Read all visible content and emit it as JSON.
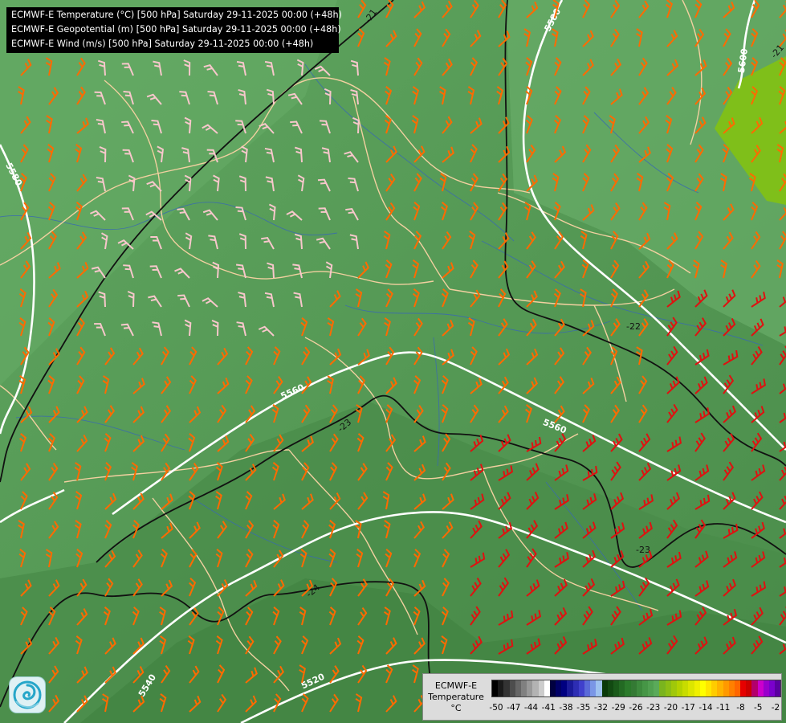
{
  "header": {
    "lines": [
      "ECMWF-E Temperature (°C) [500 hPa] Saturday 29-11-2025 00:00 (+48h)",
      "ECMWF-E Geopotential (m) [500 hPa] Saturday 29-11-2025 00:00 (+48h)",
      "ECMWF-E Wind (m/s) [500 hPa] Saturday 29-11-2025 00:00 (+48h)"
    ]
  },
  "contours": {
    "geopotential_labels": [
      "5580",
      "5600",
      "5560",
      "5560",
      "5560",
      "5540",
      "5520",
      "5540",
      "5580"
    ],
    "temperature_labels": [
      "-21",
      "-21",
      "-22",
      "-23",
      "-23",
      "-24"
    ]
  },
  "legend": {
    "line1": "ECMWF-E",
    "line2": "Temperature",
    "unit": "°C",
    "ticks": [
      "-50",
      "-47",
      "-44",
      "-41",
      "-38",
      "-35",
      "-32",
      "-29",
      "-26",
      "-23",
      "-20",
      "-17",
      "-14",
      "-11",
      "-8",
      "-5",
      "-2"
    ],
    "colors": [
      "#000000",
      "#1a1a1a",
      "#333333",
      "#4d4d4d",
      "#666666",
      "#808080",
      "#999999",
      "#b3b3b3",
      "#cccccc",
      "#ffffff",
      "#000040",
      "#000066",
      "#000080",
      "#1a1a99",
      "#2d2db3",
      "#4040cc",
      "#5a6ad8",
      "#7a96e6",
      "#9ec2f0",
      "#0a3a0a",
      "#124a12",
      "#1a5a1a",
      "#236a23",
      "#2b7a2b",
      "#347a34",
      "#3d8a3d",
      "#469646",
      "#50a050",
      "#5aaa5a",
      "#7ab41e",
      "#8cbe14",
      "#a0c80a",
      "#b4d200",
      "#c8dc00",
      "#dce600",
      "#f0f000",
      "#ffff00",
      "#ffe600",
      "#ffcc00",
      "#ffb300",
      "#ff9900",
      "#ff8000",
      "#ff6600",
      "#e60000",
      "#cc0000",
      "#b3006b",
      "#cc00cc",
      "#9900cc",
      "#7a00cc",
      "#5a00a0"
    ]
  },
  "logo": {
    "icon": "ecmwf-swirl-icon"
  },
  "palette": {
    "warm_green": "#4e944e",
    "light_green": "#64aa64",
    "warm_spot": "#7fbf1a",
    "border": "#f2d0a0",
    "river": "#3a6ab0",
    "wind_orange": "#ff6a00",
    "wind_red": "#e01010",
    "wind_pink": "#f7c7cb"
  }
}
